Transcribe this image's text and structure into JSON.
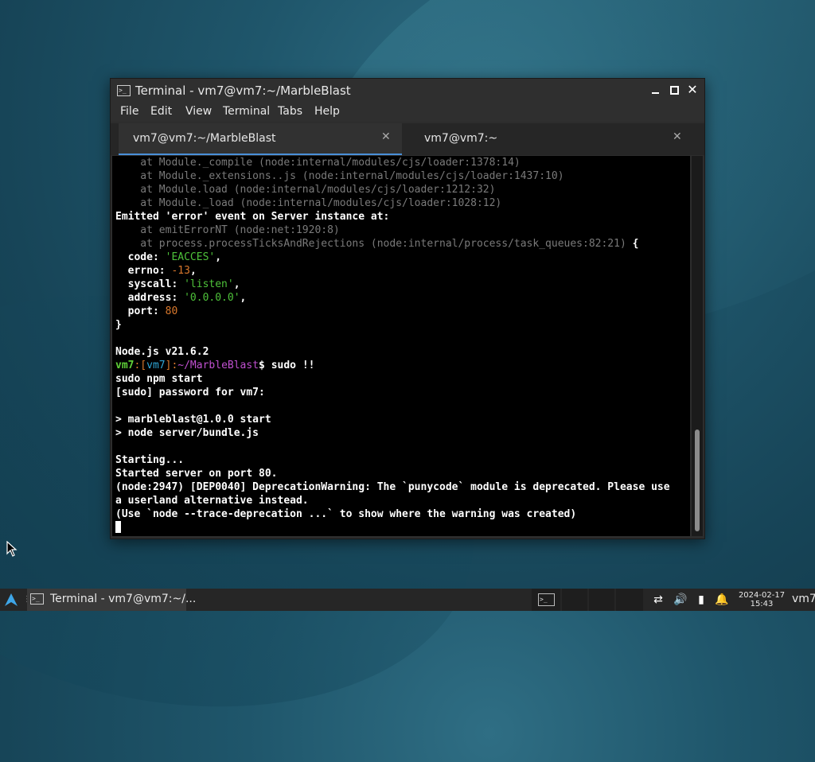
{
  "window": {
    "title": "Terminal - vm7@vm7:~/MarbleBlast",
    "controls": {
      "minimize": "minimize-icon",
      "maximize": "maximize-icon",
      "close": "✕"
    }
  },
  "menu": [
    "File",
    "Edit",
    "View",
    "Terminal",
    "Tabs",
    "Help"
  ],
  "tabs": [
    {
      "label": "vm7@vm7:~/MarbleBlast",
      "close": "✕",
      "active": true
    },
    {
      "label": "vm7@vm7:~",
      "close": "✕",
      "active": false
    }
  ],
  "terminal": {
    "lines": [
      {
        "parts": [
          {
            "t": "    at Module._compile (node:internal/modules/cjs/loader:1378:14)",
            "c": "dim"
          }
        ]
      },
      {
        "parts": [
          {
            "t": "    at Module._extensions..js (node:internal/modules/cjs/loader:1437:10)",
            "c": "dim"
          }
        ]
      },
      {
        "parts": [
          {
            "t": "    at Module.load (node:internal/modules/cjs/loader:1212:32)",
            "c": "dim"
          }
        ]
      },
      {
        "parts": [
          {
            "t": "    at Module._load (node:internal/modules/cjs/loader:1028:12)",
            "c": "dim"
          }
        ]
      },
      {
        "parts": [
          {
            "t": "Emitted 'error' event on Server instance at:",
            "c": "bold"
          }
        ]
      },
      {
        "parts": [
          {
            "t": "    at emitErrorNT (node:net:1920:8)",
            "c": "dim"
          }
        ]
      },
      {
        "parts": [
          {
            "t": "    at process.processTicksAndRejections (node:internal/process/task_queues:82:21)",
            "c": "dim"
          },
          {
            "t": " {",
            "c": "bold"
          }
        ]
      },
      {
        "parts": [
          {
            "t": "  code: ",
            "c": "bold"
          },
          {
            "t": "'EACCES'",
            "c": "green"
          },
          {
            "t": ",",
            "c": "bold"
          }
        ]
      },
      {
        "parts": [
          {
            "t": "  errno: ",
            "c": "bold"
          },
          {
            "t": "-13",
            "c": "orange"
          },
          {
            "t": ",",
            "c": "bold"
          }
        ]
      },
      {
        "parts": [
          {
            "t": "  syscall: ",
            "c": "bold"
          },
          {
            "t": "'listen'",
            "c": "green"
          },
          {
            "t": ",",
            "c": "bold"
          }
        ]
      },
      {
        "parts": [
          {
            "t": "  address: ",
            "c": "bold"
          },
          {
            "t": "'0.0.0.0'",
            "c": "green"
          },
          {
            "t": ",",
            "c": "bold"
          }
        ]
      },
      {
        "parts": [
          {
            "t": "  port: ",
            "c": "bold"
          },
          {
            "t": "80",
            "c": "orange"
          }
        ]
      },
      {
        "parts": [
          {
            "t": "}",
            "c": "bold"
          }
        ]
      },
      {
        "parts": [
          {
            "t": "",
            "c": ""
          }
        ]
      },
      {
        "parts": [
          {
            "t": "Node.js v21.6.2",
            "c": "bold"
          }
        ]
      },
      {
        "parts": [
          {
            "t": "vm7",
            "c": "promptgreen"
          },
          {
            "t": ":[",
            "c": "orange"
          },
          {
            "t": "vm7",
            "c": "cyan"
          },
          {
            "t": "]:",
            "c": "orange"
          },
          {
            "t": "~/MarbleBlast",
            "c": "purple"
          },
          {
            "t": "$ ",
            "c": "bold"
          },
          {
            "t": "sudo !!",
            "c": "bold"
          }
        ]
      },
      {
        "parts": [
          {
            "t": "sudo npm start",
            "c": "bold"
          }
        ]
      },
      {
        "parts": [
          {
            "t": "[sudo] password for vm7:",
            "c": "bold"
          }
        ]
      },
      {
        "parts": [
          {
            "t": "",
            "c": ""
          }
        ]
      },
      {
        "parts": [
          {
            "t": "> marbleblast@1.0.0 start",
            "c": "bold"
          }
        ]
      },
      {
        "parts": [
          {
            "t": "> node server/bundle.js",
            "c": "bold"
          }
        ]
      },
      {
        "parts": [
          {
            "t": "",
            "c": ""
          }
        ]
      },
      {
        "parts": [
          {
            "t": "Starting...",
            "c": "bold"
          }
        ]
      },
      {
        "parts": [
          {
            "t": "Started server on port 80.",
            "c": "bold"
          }
        ]
      },
      {
        "parts": [
          {
            "t": "(node:2947) [DEP0040] DeprecationWarning: The `punycode` module is deprecated. Please use",
            "c": "bold"
          }
        ]
      },
      {
        "parts": [
          {
            "t": "a userland alternative instead.",
            "c": "bold"
          }
        ]
      },
      {
        "parts": [
          {
            "t": "(Use `node --trace-deprecation ...` to show where the warning was created)",
            "c": "bold"
          }
        ]
      }
    ]
  },
  "taskbar": {
    "task_label": "Terminal - vm7@vm7:~/...",
    "clock_date": "2024-02-17",
    "clock_time": "15:43",
    "user": "vm7"
  }
}
